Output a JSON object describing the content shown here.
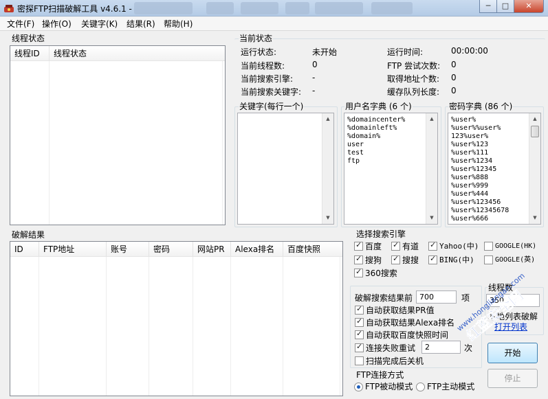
{
  "window": {
    "title": "密探FTP扫描破解工具 v4.6.1 -",
    "controls": {
      "minimize": "─",
      "maximize": "□",
      "close": "✕"
    }
  },
  "menu": [
    "文件(F)",
    "操作(O)",
    "关键字(K)",
    "结果(R)",
    "帮助(H)"
  ],
  "threads_panel": {
    "title": "线程状态",
    "columns": [
      "线程ID",
      "线程状态"
    ]
  },
  "status_panel": {
    "title": "当前状态",
    "left": [
      {
        "label": "运行状态:",
        "value": "未开始"
      },
      {
        "label": "当前线程数:",
        "value": "0"
      },
      {
        "label": "当前搜索引擎:",
        "value": "-"
      },
      {
        "label": "当前搜索关键字:",
        "value": "-"
      }
    ],
    "right": [
      {
        "label": "运行时间:",
        "value": "00:00:00"
      },
      {
        "label": "FTP 尝试次数:",
        "value": "0"
      },
      {
        "label": "取得地址个数:",
        "value": "0"
      },
      {
        "label": "缓存队列长度:",
        "value": "0"
      }
    ]
  },
  "keywords_panel": {
    "title": "关键字(每行一个)"
  },
  "username_dict": {
    "title": "用户名字典 (6 个)",
    "items": [
      "%domaincenter%",
      "%domainleft%",
      "%domain%",
      "user",
      "test",
      "ftp"
    ]
  },
  "password_dict": {
    "title": "密码字典 (86 个)",
    "items": [
      "%user%",
      "%user%%user%",
      "123%user%",
      "%user%123",
      "%user%111",
      "%user%1234",
      "%user%12345",
      "%user%888",
      "%user%999",
      "%user%444",
      "%user%123456",
      "%user%12345678",
      "%user%666"
    ]
  },
  "results_panel": {
    "title": "破解结果",
    "columns": [
      "ID",
      "FTP地址",
      "账号",
      "密码",
      "网站PR",
      "Alexa排名",
      "百度快照"
    ]
  },
  "engines": {
    "title": "选择搜索引擎",
    "items": [
      {
        "label": "百度",
        "checked": true
      },
      {
        "label": "有道",
        "checked": true
      },
      {
        "label": "Yahoo(中)",
        "checked": true
      },
      {
        "label": "GOOGLE(HK)",
        "checked": false
      },
      {
        "label": "搜狗",
        "checked": true
      },
      {
        "label": "搜搜",
        "checked": true
      },
      {
        "label": "BING(中)",
        "checked": true
      },
      {
        "label": "GOOGLE(英)",
        "checked": false
      },
      {
        "label": "360搜索",
        "checked": true
      }
    ]
  },
  "options": {
    "result_prefix": "破解搜索结果前",
    "result_count": "700",
    "result_suffix": "项",
    "auto_pr": {
      "label": "自动获取结果PR值",
      "checked": true
    },
    "auto_alexa": {
      "label": "自动获取结果Alexa排名",
      "checked": true
    },
    "auto_baidu": {
      "label": "自动获取百度快照时间",
      "checked": true
    },
    "retry": {
      "label": "连接失败重试",
      "checked": true,
      "value": "2",
      "suffix": "次"
    },
    "shutdown": {
      "label": "扫描完成后关机",
      "checked": false
    }
  },
  "threads_setting": {
    "title": "线程数",
    "value": "350",
    "local_list": "本地列表破解",
    "open_list": "打开列表"
  },
  "ftp_mode": {
    "title": "FTP连接方式",
    "options": [
      {
        "label": "FTP被动模式",
        "checked": true
      },
      {
        "label": "FTP主动模式",
        "checked": false
      }
    ]
  },
  "buttons": {
    "start": "开始",
    "stop": "停止"
  },
  "watermark": {
    "text": "红蓝安全网",
    "url": "www.hongliangan.com",
    "colors": {
      "blue": "#3a63c9",
      "red": "#d9342b"
    }
  },
  "colors": {
    "link": "#0033cc",
    "panel_border": "#d5dfe5"
  }
}
